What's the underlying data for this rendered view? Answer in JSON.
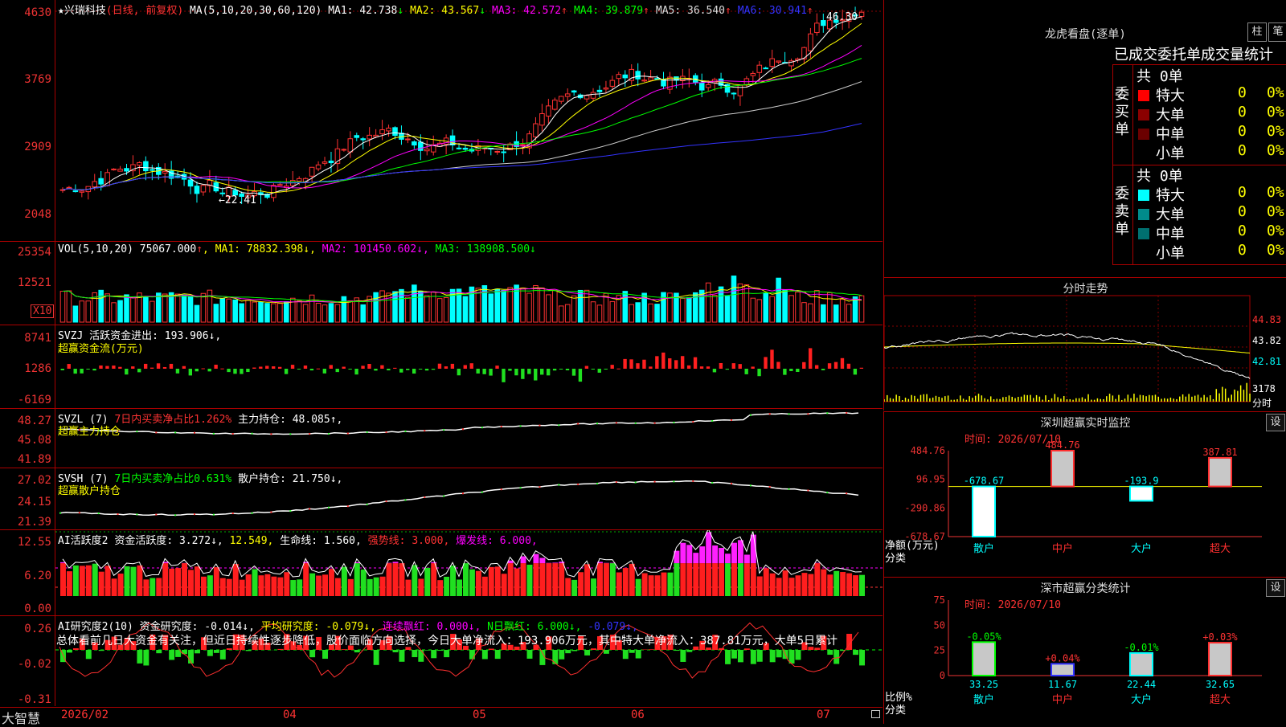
{
  "stock": {
    "name": "兴瑞科技",
    "mode": "(日线, 前复权)",
    "star": "★"
  },
  "ma_header": {
    "label": "MA(5,10,20,30,60,120)",
    "items": [
      {
        "name": "MA1",
        "value": "42.738",
        "arrow": "↓",
        "color": "#ffffff"
      },
      {
        "name": "MA2",
        "value": "43.567",
        "arrow": "↓",
        "color": "#ffff00"
      },
      {
        "name": "MA3",
        "value": "42.572",
        "arrow": "↑",
        "color": "#ff00ff"
      },
      {
        "name": "MA4",
        "value": "39.879",
        "arrow": "↑",
        "color": "#00ff00"
      },
      {
        "name": "MA5",
        "value": "36.540",
        "arrow": "↑",
        "color": "#dddddd"
      },
      {
        "name": "MA6",
        "value": "30.941",
        "arrow": "↑",
        "color": "#3333ff"
      }
    ]
  },
  "price_axis": [
    "4630",
    "3769",
    "2909",
    "2048"
  ],
  "price_high": "46.30",
  "price_low": "←22.41",
  "vol_header": {
    "label": "VOL(5,10,20)",
    "value": "75067.000",
    "arrow": "↑",
    "ma1": "MA1: 78832.398↓",
    "ma2": "MA2: 101450.602↓",
    "ma3": "MA3: 138908.500↓"
  },
  "vol_axis": [
    "25354",
    "12521"
  ],
  "vol_unit": "X10",
  "svzj": {
    "line1": "SVZJ  活跃资金进出: 193.906↓,",
    "line2": "超赢资金流(万元)",
    "axis": [
      "8741",
      "1286",
      "-6169"
    ]
  },
  "svzl": {
    "prefix": "SVZL (7)",
    "mid": "7日内买卖净占比1.262%",
    "rest": "主力持仓: 48.085↑,",
    "line2": "超赢主力持仓",
    "axis": [
      "48.27",
      "45.08",
      "41.89"
    ]
  },
  "svsh": {
    "prefix": "SVSH (7)",
    "mid": "7日内买卖净占比0.631%",
    "rest": "散户持仓: 21.750↓,",
    "line2": "超赢散户持仓",
    "axis": [
      "27.02",
      "24.15",
      "21.39"
    ]
  },
  "ai1": {
    "a": "AI活跃度2",
    "b": "资金活跃度: 3.272↓,",
    "c": "12.549,",
    "d": "生命线: 1.560,",
    "e": "强势线: 3.000,",
    "f": "爆发线: 6.000,",
    "axis": [
      "12.55",
      "6.20",
      "0.00"
    ]
  },
  "ai2": {
    "a": "AI研究度2(10)",
    "b": "资金研究度: -0.014↓,",
    "c": "平均研究度: -0.079↓,",
    "d": "连续飘红: 0.000↓,",
    "e": "N日飘红: 6.000↓,",
    "f": "-0.079↓,",
    "axis": [
      "0.26",
      "-0.02",
      "-0.31"
    ],
    "comment": "总体看前几日大资金有关注，但近日持续性逐步降低，股价面临方向选择，今日大单净流入：193.906万元，其中特大单净流入：387.81万元，大单5日累计"
  },
  "dates": [
    "2026/02",
    "04",
    "05",
    "06",
    "07"
  ],
  "brand": "大智慧",
  "right": {
    "lhk_title": "龙虎看盘(逐单)",
    "btn_bar": "柱",
    "btn_pen": "笔",
    "tabs_title": "已成交委托单成交量统计",
    "buy": {
      "label": "委买单",
      "total": "共 0单",
      "rows": [
        {
          "name": "特大",
          "qty": "0",
          "pct": "0%",
          "color": "#ff0000"
        },
        {
          "name": "大单",
          "qty": "0",
          "pct": "0%",
          "color": "#8b0000"
        },
        {
          "name": "中单",
          "qty": "0",
          "pct": "0%",
          "color": "#6b0000"
        },
        {
          "name": "小单",
          "qty": "0",
          "pct": "0%",
          "color": ""
        }
      ]
    },
    "sell": {
      "label": "委卖单",
      "total": "共 0单",
      "rows": [
        {
          "name": "特大",
          "qty": "0",
          "pct": "0%",
          "color": "#00ffff"
        },
        {
          "name": "大单",
          "qty": "0",
          "pct": "0%",
          "color": "#008b8b"
        },
        {
          "name": "中单",
          "qty": "0",
          "pct": "0%",
          "color": "#007070"
        },
        {
          "name": "小单",
          "qty": "0",
          "pct": "0%",
          "color": ""
        }
      ]
    },
    "intraday_title": "分时走势",
    "intraday_axis": [
      "44.83",
      "43.82",
      "42.81"
    ],
    "intraday_vol": "3178",
    "intraday_vol_unit": "分时",
    "monitor": {
      "title": "深圳超赢实时监控",
      "set": "设",
      "time": "时间: 2026/07/10",
      "axis": [
        "484.76",
        "96.95",
        "-290.86",
        "-678.67"
      ],
      "ylabel1": "净额(万元)",
      "ylabel2": "分类",
      "bars": [
        {
          "cat": "散户",
          "value": "-678.67"
        },
        {
          "cat": "中户",
          "value": "484.76"
        },
        {
          "cat": "大户",
          "value": "-193.9"
        },
        {
          "cat": "超大",
          "value": "387.81"
        }
      ]
    },
    "classify": {
      "title": "深市超赢分类统计",
      "set": "设",
      "time": "时间: 2026/07/10",
      "axis": [
        "75",
        "50",
        "25",
        "0"
      ],
      "ylabel1": "比例%",
      "ylabel2": "分类",
      "bars": [
        {
          "cat": "散户",
          "pct": "-0.05%",
          "value": "33.25"
        },
        {
          "cat": "中户",
          "pct": "+0.04%",
          "value": "11.67"
        },
        {
          "cat": "大户",
          "pct": "-0.01%",
          "value": "22.44"
        },
        {
          "cat": "超大",
          "pct": "+0.03%",
          "value": "32.65"
        }
      ]
    }
  }
}
